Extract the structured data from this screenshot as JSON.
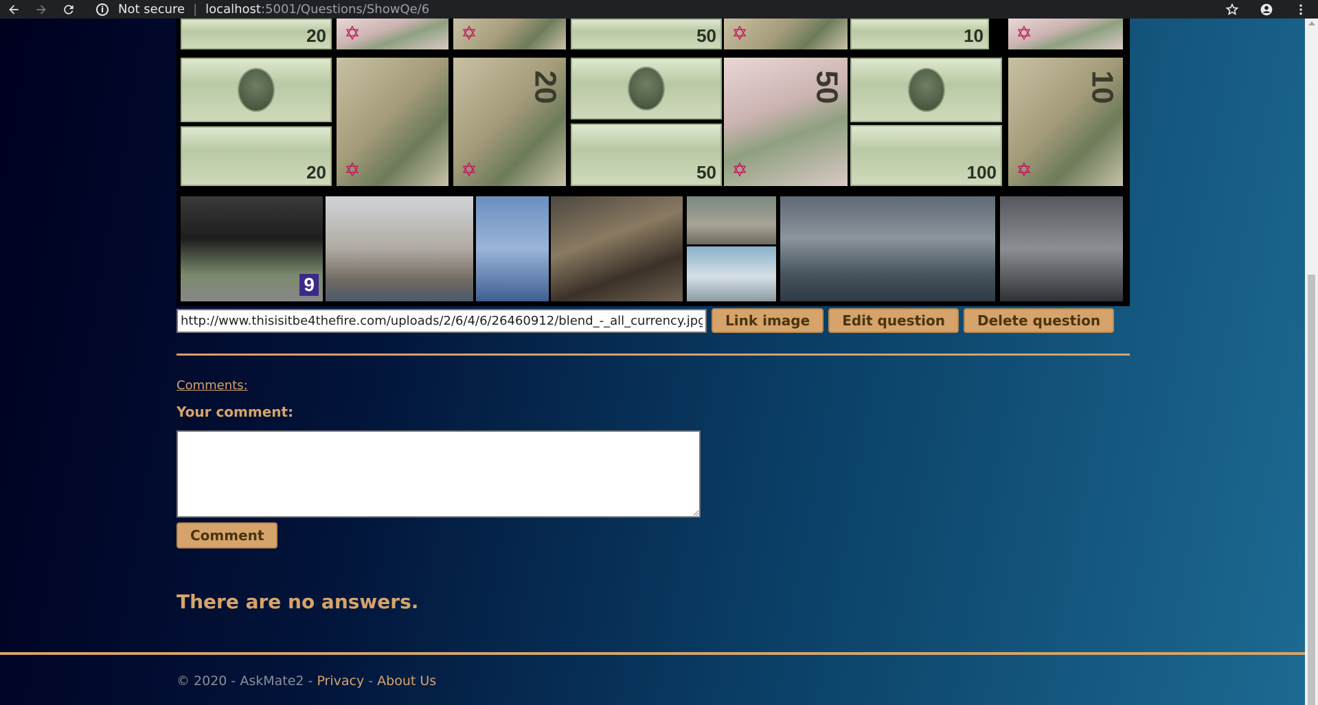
{
  "browser": {
    "security_label": "Not secure",
    "url_host": "localhost",
    "url_path": ":5001/Questions/ShowQe/6"
  },
  "question": {
    "image_url_value": "http://www.thisisitbe4thefire.com/uploads/2/6/4/6/26460912/blend_-_all_currency.jpg",
    "collage_numerals": [
      "20",
      "20",
      "50",
      "50",
      "10",
      "100",
      "20",
      "50",
      "10",
      "9"
    ],
    "link_image_label": "Link image",
    "edit_label": "Edit question",
    "delete_label": "Delete question"
  },
  "comments": {
    "link_label": "Comments:",
    "your_comment_label": "Your comment:",
    "textarea_value": "",
    "submit_label": "Comment"
  },
  "answers": {
    "empty_text": "There are no answers."
  },
  "footer": {
    "copyright": "© 2020 - AskMate2 - ",
    "privacy_label": "Privacy",
    "separator": " - ",
    "about_label": "About Us"
  },
  "colors": {
    "accent": "#d6a46a",
    "chrome_bg": "#202124"
  }
}
